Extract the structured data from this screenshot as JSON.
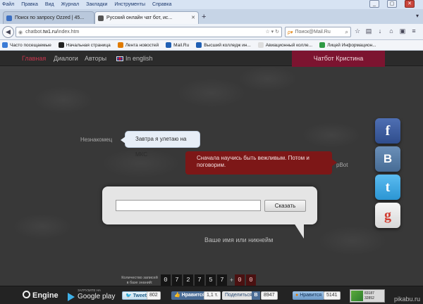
{
  "browser": {
    "menu": [
      "Файл",
      "Правка",
      "Вид",
      "Журнал",
      "Закладки",
      "Инструменты",
      "Справка"
    ],
    "window_controls": [
      "_",
      "▢",
      "✕"
    ],
    "tabs": [
      {
        "label": "Поиск по запросу Ozzed | 45...",
        "active": false
      },
      {
        "label": "Русский онлайн чат бот, ис...",
        "active": true
      }
    ],
    "new_tab": "+",
    "url_plain": "chatbot.",
    "url_bold": "tw1.ru",
    "url_path": "/index.htm",
    "search_placeholder": "Поиск@Mail.Ru",
    "bookmarks": [
      {
        "label": "Часто посещаемые",
        "color": "#3b7bd6"
      },
      {
        "label": "Начальная страница",
        "color": "#222222"
      },
      {
        "label": "Лента новостей",
        "color": "#e07b00"
      },
      {
        "label": "Mail.Ru",
        "color": "#1f5fb4"
      },
      {
        "label": "Высший колледж ин...",
        "color": "#1f5fb4"
      },
      {
        "label": "Авиационный колле...",
        "color": "#dddddd"
      },
      {
        "label": "Лицей Информацион...",
        "color": "#2e9a44"
      }
    ]
  },
  "site": {
    "nav": [
      "Главная",
      "Диалоги",
      "Авторы",
      "In english"
    ],
    "chatbot_tab": "Чатбот Кристина",
    "user_name": "Незнакомец",
    "user_message": "Завтра я улетаю на МКС",
    "bot_name": "pBot",
    "bot_message": "Сначала научись быть вежливым. Потом и поговорим.",
    "send_button": "Сказать",
    "name_placeholder": "Ваше имя или никнейм",
    "counter_label": "Количество записей в базе знаний:",
    "counter_digits": [
      "0",
      "7",
      "2",
      "7",
      "5",
      "7"
    ],
    "counter_plus": "+",
    "counter_extra": [
      "0",
      "0"
    ],
    "social": {
      "facebook": "f",
      "vkontakte": "B",
      "twitter": "t",
      "google": "g"
    }
  },
  "footer": {
    "engine": "Engine",
    "gplay_small": "ЗАГРУЗИТЕ НА",
    "gplay_big": "Google play",
    "tweet": "Tweet",
    "tweet_count": "802",
    "like": "Нравится",
    "like_count": "1,1 т.",
    "share": "Поделиться",
    "vk": "B",
    "share_count": "8947",
    "ok_like": "Нравится",
    "ok_count": "5141",
    "stat_lines": [
      "83187",
      "32852"
    ],
    "watermark": "pikabu.ru"
  },
  "colors": {
    "accent": "#c8364f",
    "chatbot_tab": "#7c1430",
    "bot_bubble": "#7d1717"
  }
}
